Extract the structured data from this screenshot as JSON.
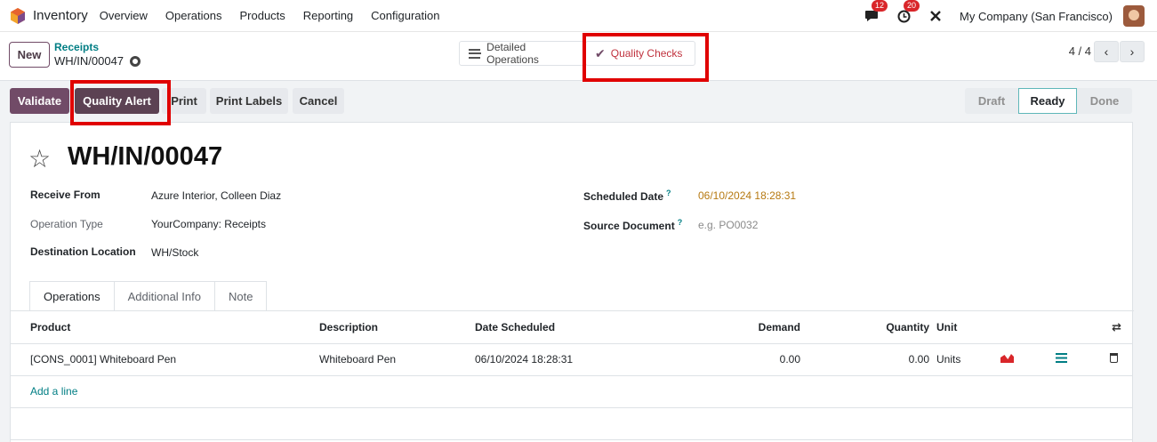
{
  "navbar": {
    "app_name": "Inventory",
    "menu": [
      "Overview",
      "Operations",
      "Products",
      "Reporting",
      "Configuration"
    ],
    "messages_count": "12",
    "activities_count": "20",
    "company": "My Company (San Francisco)"
  },
  "control": {
    "new_label": "New",
    "breadcrumb_parent": "Receipts",
    "breadcrumb_current": "WH/IN/00047",
    "detailed_operations_label": "Detailed Operations",
    "quality_checks_label": "Quality Checks",
    "pager": "4 / 4"
  },
  "actions": {
    "validate": "Validate",
    "quality_alert": "Quality Alert",
    "print": "Print",
    "print_labels": "Print Labels",
    "cancel": "Cancel"
  },
  "stages": [
    "Draft",
    "Ready",
    "Done"
  ],
  "record": {
    "title": "WH/IN/00047",
    "receive_from_label": "Receive From",
    "receive_from": "Azure Interior, Colleen Diaz",
    "operation_type_label": "Operation Type",
    "operation_type": "YourCompany: Receipts",
    "destination_label": "Destination Location",
    "destination": "WH/Stock",
    "scheduled_date_label": "Scheduled Date",
    "scheduled_date": "06/10/2024 18:28:31",
    "source_document_label": "Source Document",
    "source_document_placeholder": "e.g. PO0032"
  },
  "tabs": [
    "Operations",
    "Additional Info",
    "Note"
  ],
  "table": {
    "columns": [
      "Product",
      "Description",
      "Date Scheduled",
      "Demand",
      "Quantity",
      "Unit"
    ],
    "rows": [
      {
        "product": "[CONS_0001] Whiteboard Pen",
        "description": "Whiteboard Pen",
        "date": "06/10/2024 18:28:31",
        "demand": "0.00",
        "quantity": "0.00",
        "unit": "Units"
      }
    ],
    "add_line": "Add a line"
  },
  "colors": {
    "brand": "#714b67",
    "highlight": "#e00000",
    "link": "#017e84"
  }
}
